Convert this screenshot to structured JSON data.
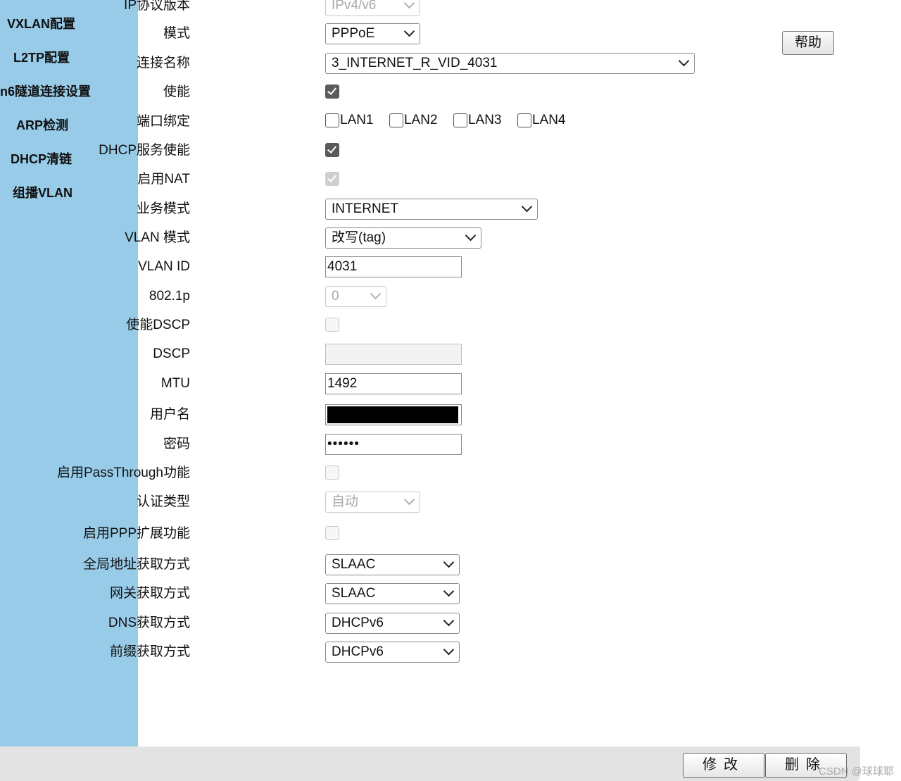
{
  "sidebar": {
    "items": [
      {
        "label": "VXLAN配置"
      },
      {
        "label": "L2TP配置"
      },
      {
        "label": "n6隧道连接设置"
      },
      {
        "label": "ARP检测"
      },
      {
        "label": "DHCP清链"
      },
      {
        "label": "组播VLAN"
      }
    ]
  },
  "help_label": "帮助",
  "form": {
    "ip_version": {
      "label": "IP协议版本",
      "value": "IPv4/v6"
    },
    "mode": {
      "label": "模式",
      "value": "PPPoE"
    },
    "connection_name": {
      "label": "连接名称",
      "value": "3_INTERNET_R_VID_4031"
    },
    "enable": {
      "label": "使能",
      "checked": true
    },
    "port_binding": {
      "label": "端口绑定",
      "options": [
        "LAN1",
        "LAN2",
        "LAN3",
        "LAN4"
      ]
    },
    "dhcp_service": {
      "label": "DHCP服务使能",
      "checked": true
    },
    "nat": {
      "label": "启用NAT",
      "checked": true
    },
    "service_mode": {
      "label": "业务模式",
      "value": "INTERNET"
    },
    "vlan_mode": {
      "label": "VLAN 模式",
      "value": "改写(tag)"
    },
    "vlan_id": {
      "label": "VLAN ID",
      "value": "4031"
    },
    "dot1p": {
      "label": "802.1p",
      "value": "0"
    },
    "enable_dscp": {
      "label": "使能DSCP",
      "checked": false
    },
    "dscp": {
      "label": "DSCP",
      "value": ""
    },
    "mtu": {
      "label": "MTU",
      "value": "1492"
    },
    "username": {
      "label": "用户名",
      "value": ""
    },
    "password": {
      "label": "密码",
      "value": "••••••"
    },
    "passthrough": {
      "label": "启用PassThrough功能",
      "checked": false
    },
    "auth_type": {
      "label": "认证类型",
      "value": "自动"
    },
    "ppp_ext": {
      "label": "启用PPP扩展功能",
      "checked": false
    },
    "global_addr": {
      "label": "全局地址获取方式",
      "value": "SLAAC"
    },
    "gateway": {
      "label": "网关获取方式",
      "value": "SLAAC"
    },
    "dns": {
      "label": "DNS获取方式",
      "value": "DHCPv6"
    },
    "prefix": {
      "label": "前缀获取方式",
      "value": "DHCPv6"
    }
  },
  "footer": {
    "modify_label": "修改",
    "delete_label": "删除",
    "watermark": "CSDN @球球耶"
  },
  "colors": {
    "sidebar_bg": "#97cbe8",
    "footer_bg": "#e3e3e3"
  }
}
